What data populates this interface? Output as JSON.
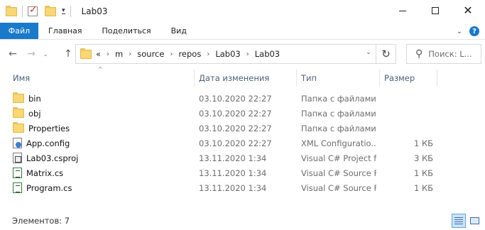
{
  "window": {
    "title": "Lab03",
    "minimize_icon": "minimize-icon",
    "maximize_icon": "maximize-icon",
    "close_icon": "close-icon",
    "close_glyph": "✕"
  },
  "quick_access": {
    "folder_icon": "folder-icon",
    "properties_icon": "properties-icon",
    "new_folder_icon": "new-folder-icon",
    "customize_glyph": "▾"
  },
  "ribbon": {
    "tabs": [
      {
        "label": "Файл",
        "accent": "#1979ca"
      },
      {
        "label": "Главная"
      },
      {
        "label": "Поделиться"
      },
      {
        "label": "Вид"
      }
    ],
    "expand_glyph": "⌄",
    "help_glyph": "?"
  },
  "nav": {
    "back_glyph": "←",
    "forward_glyph": "→",
    "recent_glyph": "⌄",
    "up_glyph": "↑",
    "overflow": "«",
    "breadcrumb": [
      "m",
      "source",
      "repos",
      "Lab03",
      "Lab03"
    ],
    "separator": "›",
    "address_dropdown_glyph": "⌄",
    "refresh_glyph": "↻",
    "search_icon_glyph": "⚲",
    "search_placeholder": "Поиск: L..."
  },
  "columns": {
    "name": "Имя",
    "date": "Дата изменения",
    "type": "Тип",
    "size": "Размер",
    "sort_glyph": "^"
  },
  "files": [
    {
      "name": "bin",
      "date": "03.10.2020 22:27",
      "type": "Папка с файлами",
      "size": "",
      "icon": "folder-icon"
    },
    {
      "name": "obj",
      "date": "03.10.2020 22:27",
      "type": "Папка с файлами",
      "size": "",
      "icon": "folder-icon"
    },
    {
      "name": "Properties",
      "date": "03.10.2020 22:27",
      "type": "Папка с файлами",
      "size": "",
      "icon": "folder-icon"
    },
    {
      "name": "App.config",
      "date": "03.10.2020 22:27",
      "type": "XML Configuratio...",
      "size": "1 КБ",
      "icon": "config-file-icon"
    },
    {
      "name": "Lab03.csproj",
      "date": "13.11.2020 1:34",
      "type": "Visual C# Project f...",
      "size": "3 КБ",
      "icon": "csproj-file-icon"
    },
    {
      "name": "Matrix.cs",
      "date": "13.11.2020 1:34",
      "type": "Visual C# Source F...",
      "size": "1 КБ",
      "icon": "cs-file-icon"
    },
    {
      "name": "Program.cs",
      "date": "13.11.2020 1:34",
      "type": "Visual C# Source F...",
      "size": "1 КБ",
      "icon": "cs-file-icon"
    }
  ],
  "status": {
    "items_label": "Элементов: 7",
    "details_view_icon": "details-view-icon",
    "tiles_view_icon": "large-icons-view-icon"
  }
}
